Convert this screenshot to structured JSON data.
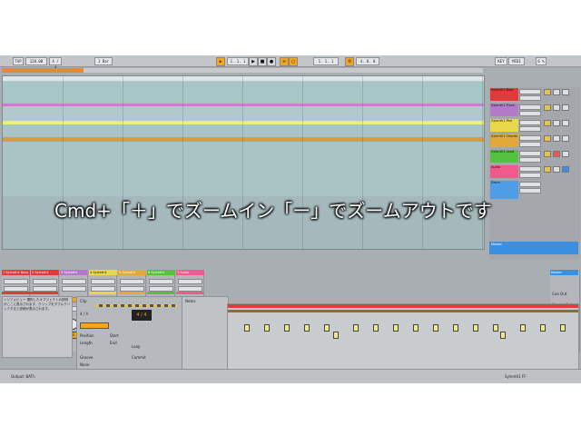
{
  "caption": "Cmd+「＋」でズームイン「ー」でズームアウトです",
  "transport": {
    "tempo": "120.00",
    "signature": "4 / 4",
    "bar": "1 Bar",
    "position": "1. 1. 1",
    "loop_start": "1. 1. 1",
    "loop_len": "4. 0. 0",
    "cpu": "6 %",
    "key": "KEY",
    "midi": "MIDI"
  },
  "tracks": [
    {
      "name": "Sylenth1 Bass",
      "color": "#e03a3a"
    },
    {
      "name": "Sylenth1 Pluck",
      "color": "#b27ac9"
    },
    {
      "name": "Sylenth1 Pad",
      "color": "#e8d74b"
    },
    {
      "name": "Sylenth1 Chords",
      "color": "#e0a93a"
    },
    {
      "name": "Sylenth1 Lead",
      "color": "#55c23f"
    },
    {
      "name": "Audio",
      "color": "#ef5b8c"
    },
    {
      "name": "Drum",
      "color": "#4e9de6"
    }
  ],
  "track_io": {
    "input": "All Ins",
    "monitor": "Auto",
    "output": "Master"
  },
  "mixer": {
    "strips": [
      {
        "name": "1 Sylenth1 Bass",
        "value": "1",
        "color": "#e03a3a"
      },
      {
        "name": "2 Sylenth1",
        "value": "2",
        "color": "#e03a3a"
      },
      {
        "name": "3 Sylenth1",
        "value": "3",
        "color": "#b27ac9"
      },
      {
        "name": "4 Sylenth1",
        "value": "4",
        "color": "#e8d74b"
      },
      {
        "name": "5 Sylenth1",
        "value": "5",
        "color": "#e0a93a"
      },
      {
        "name": "6 Sylenth1",
        "value": "6",
        "color": "#55c23f"
      },
      {
        "name": "7 Audio",
        "value": "7",
        "color": "#ef5b8c"
      }
    ],
    "master_name": "Master",
    "cue_out": "Cue Out",
    "master_out": "Master Out"
  },
  "info_text": "インフォビュー 選択したオブジェクトの説明がここに表示されます。クリップをダブルクリックすると詳細が表示されます。",
  "clip": {
    "title": "Clip",
    "signature": "4 / 4",
    "start": "Start",
    "end": "End",
    "loop": "Loop",
    "position": "Position",
    "length": "Length",
    "commit": "Commit",
    "groove": "Groove",
    "none": "None",
    "notes": "Notes"
  },
  "status": {
    "left": "Output: BATh",
    "right": "Sylenth1 FF"
  }
}
